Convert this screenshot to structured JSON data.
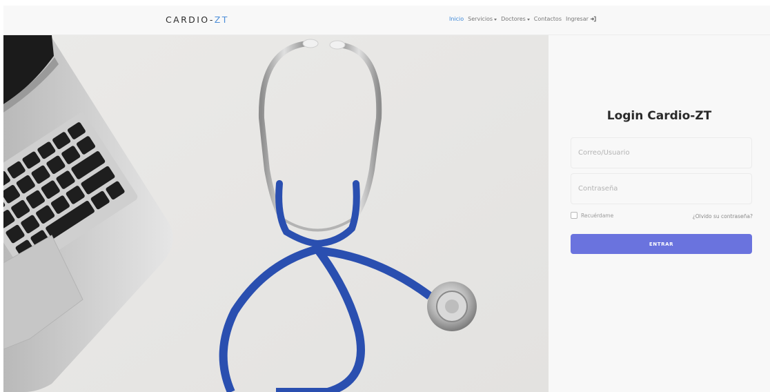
{
  "brand": {
    "prefix": "CARDIO-",
    "suffix": "ZT"
  },
  "nav": {
    "items": [
      {
        "label": "Inicio",
        "active": true,
        "dropdown": false
      },
      {
        "label": "Servicios",
        "active": false,
        "dropdown": true
      },
      {
        "label": "Doctores",
        "active": false,
        "dropdown": true
      },
      {
        "label": "Contactos",
        "active": false,
        "dropdown": false
      },
      {
        "label": "Ingresar",
        "active": false,
        "dropdown": false,
        "icon": "sign-in-icon"
      }
    ]
  },
  "hero": {
    "image": "stethoscope-and-laptop-photo"
  },
  "login": {
    "title": "Login Cardio-ZT",
    "user_placeholder": "Correo/Usuario",
    "user_value": "",
    "password_placeholder": "Contraseña",
    "password_value": "",
    "remember_label": "Recuérdame",
    "remember_checked": false,
    "forgot_label": "¿Olvido su contraseña?",
    "submit_label": "ENTRAR"
  },
  "colors": {
    "accent": "#3a86d8",
    "button": "#6a73de",
    "panel_bg": "#f8f8f8",
    "tube": "#2a4fb0"
  }
}
